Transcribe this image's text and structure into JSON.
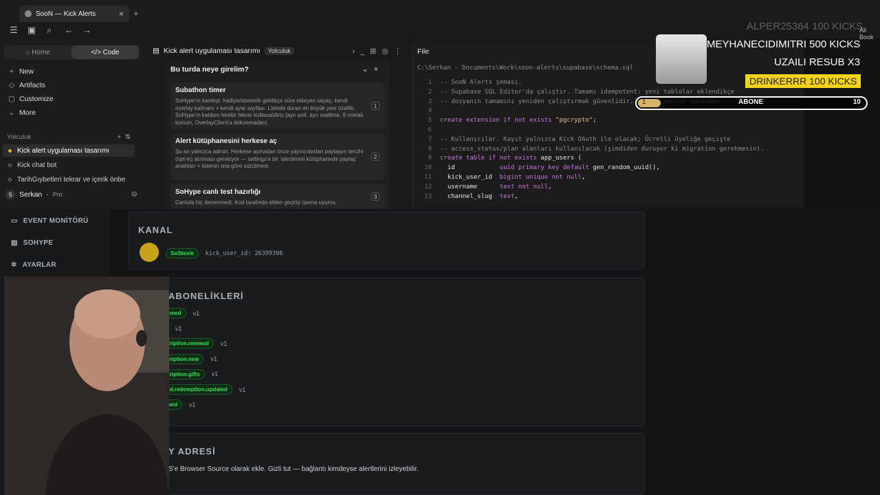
{
  "browser": {
    "tab_title": "SooN — Kick Alerts",
    "bookmarks_label": "All Book"
  },
  "app": {
    "mode_tabs": [
      "Home",
      "Code"
    ],
    "nav": [
      {
        "icon": "plus-icon",
        "label": "New"
      },
      {
        "icon": "artifacts-icon",
        "label": "Artifacts"
      },
      {
        "icon": "customize-icon",
        "label": "Customize"
      },
      {
        "icon": "chevron-down-icon",
        "label": "More"
      }
    ],
    "section_label": "Yolculuk",
    "conversations": [
      {
        "label": "Kick alert uygulaması tasarımı",
        "active": true
      },
      {
        "label": "Kick chat bot",
        "active": false
      },
      {
        "label": "TarihGıybetleri tekrar ve içerik önbe",
        "active": false
      }
    ],
    "user": {
      "initial": "S",
      "name": "Serkan",
      "plan": "Pro"
    }
  },
  "conversation": {
    "title": "Kick alert uygulaması tasarımı",
    "badge": "Yolculuk",
    "question_title": "Bu turda neye girelim?",
    "options": [
      {
        "title": "Subathon timer",
        "desc": "SoHype'ın kardeşi: hediye/abonelik geldikçe süre ekleyen sayaç, kendi overlay katmanı + kendi ayar sayfası. Listede duran en büyük yeni özellik; SoHype'ın kalıbını birebir tekrar kullanabiliriz (ayrı poll, ayrı realtime, 9 noktalı konum, OverlayClient'a dokunmadan).",
        "num": "1"
      },
      {
        "title": "Alert kütüphanesini herkese aç",
        "desc": "Şu an yalnızca admin. Herkese açmadan önce yayıncılardan paylaşım tercihi (opt-in) alınması gerekiyor — settings'e bir 'alertlerimi kütüphanede paylaş' anahtarı + listenin ona göre süzülmesi.",
        "num": "2"
      },
      {
        "title": "SoHype canlı test hazırlığı",
        "desc": "Canlıda hiç denenmedi. Kod tarafında elden geçirip (şema uyumu,",
        "num": "3"
      }
    ]
  },
  "file": {
    "header": "File",
    "path": "C:\\Serkan - Documents\\Work\\soon-alerts\\supabase\\schema.sql",
    "lines": [
      "-- SooN Alerts şeması.",
      "-- Supabase SQL Editor'da çalıştır. Tamamı idempotent: yeni tablolar eklendikçe",
      "-- dosyanın tamamını yeniden çalıştırmak güvenlidir, mevcut veriye dokunmaz.",
      "",
      "create extension if not exists \"pgcrypto\";",
      "",
      "-- Kullanıcılar. Kayıt yalnızca Kick OAuth ile olacak; Ücretli üyeliğe geçişte",
      "-- access_status/plan alanları kullanılacak (şimdiden duruyor ki migration gerekmesin).",
      "create table if not exists app_users (",
      "  id            uuid primary key default gen_random_uuid(),",
      "  kick_user_id  bigint unique not null,",
      "  username      text not null,",
      "  channel_slug  text,"
    ]
  },
  "dashboard": {
    "nav": [
      {
        "icon": "monitor-icon",
        "label": "EVENT MONİTÖRÜ"
      },
      {
        "icon": "hype-icon",
        "label": "SOHYPE"
      },
      {
        "icon": "gear-icon",
        "label": "AYARLAR"
      }
    ],
    "kanal": {
      "heading": "KANAL",
      "channel_name": "SoStevie",
      "user_id": "kick_user_id: 26399306"
    },
    "abonelikler": {
      "heading": "ABONELİKLERİ",
      "events": [
        {
          "name": ".banned",
          "version": "v1"
        },
        {
          "name": "d",
          "version": "v1"
        },
        {
          "name": "bscription.renewal",
          "version": "v1"
        },
        {
          "name": "bscription.new",
          "version": "v1"
        },
        {
          "name": "bscription.gifts",
          "version": "v1"
        },
        {
          "name": "ward.redemption.updated",
          "version": "v1"
        },
        {
          "name": "llowed",
          "version": "v1"
        }
      ]
    },
    "adres": {
      "heading": "Y ADRESİ",
      "text": "S'e Browser Source olarak ekle. Gizli tut — bağlantı kimdeyse alertlerini izleyebilir."
    }
  },
  "overlay": {
    "faded_line": "ALPER25364  100 KICKS",
    "line1": "MEYHANECIDIMITRI  500 KICKS",
    "line2": "UZAILI  RESUB X3",
    "highlight": "DRINKERRR  100 KICKS",
    "bar_label": "ABONE",
    "bar_start": "1",
    "bar_end": "10",
    "bar_progress": 0.1,
    "highlight_color": "#f2d21c"
  }
}
